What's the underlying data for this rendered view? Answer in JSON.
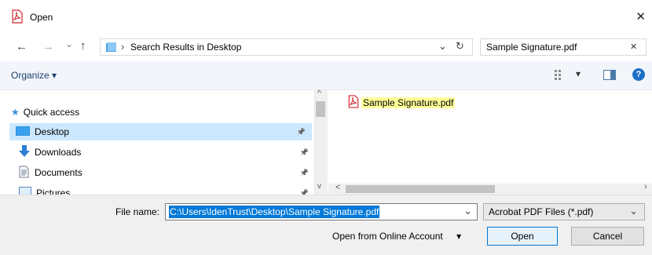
{
  "window": {
    "title": "Open",
    "close_glyph": "✕"
  },
  "nav": {
    "back_glyph": "←",
    "forward_glyph": "→",
    "recent_glyph": "⌄",
    "up_glyph": "↑",
    "address_separator": "›",
    "address_text": "Search Results in Desktop",
    "address_dropdown_glyph": "⌄",
    "refresh_glyph": "↻",
    "search_value": "Sample Signature.pdf",
    "search_clear_glyph": "✕"
  },
  "toolbar": {
    "organize_label": "Organize",
    "organize_caret": "▾",
    "view_caret": "▾",
    "help_glyph": "?"
  },
  "sidebar": {
    "items": [
      {
        "label": "Quick access"
      },
      {
        "label": "Desktop"
      },
      {
        "label": "Downloads"
      },
      {
        "label": "Documents"
      },
      {
        "label": "Pictures"
      }
    ],
    "pin_glyph": "📌"
  },
  "results": {
    "items": [
      {
        "label": "Sample Signature.pdf"
      }
    ],
    "scroll_left_glyph": "<",
    "scroll_right_glyph": "›",
    "scroll_up_glyph": "^",
    "scroll_down_glyph": "v"
  },
  "bottom": {
    "filename_label": "File name:",
    "filename_value": "C:\\Users\\IdenTrust\\Desktop\\Sample Signature.pdf",
    "filename_caret": "⌄",
    "filetype_value": "Acrobat PDF Files (*.pdf)",
    "filetype_caret": "⌄",
    "online_label": "Open from Online Account",
    "online_caret": "▾",
    "open_label": "Open",
    "cancel_label": "Cancel"
  },
  "colors": {
    "accent": "#0078d7",
    "selection": "#cce8ff",
    "highlight": "#ffff99",
    "pdf_red": "#d4242a"
  }
}
